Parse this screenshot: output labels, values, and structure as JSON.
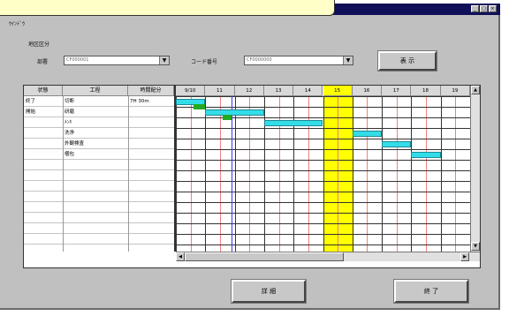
{
  "window": {
    "title_controls": [
      "_",
      "□",
      "×"
    ],
    "top_label": "ｳｲﾝﾄﾞｳ",
    "sub_label": "地区区分"
  },
  "filters": {
    "field1_label": "部署",
    "field1_value": "CF000001",
    "field2_label": "コード番号",
    "field2_value": "CF0000000",
    "show_button": "表 示"
  },
  "left_table": {
    "headers": [
      "状態",
      "工程",
      "時間配分"
    ],
    "rows": [
      {
        "status": "終了",
        "process": "切断",
        "time": "7H 30m"
      },
      {
        "status": "開始",
        "process": "研磨",
        "time": ""
      },
      {
        "status": "",
        "process": "ﾒﾝｷ",
        "time": ""
      },
      {
        "status": "",
        "process": "洗浄",
        "time": ""
      },
      {
        "status": "",
        "process": "外観検査",
        "time": ""
      },
      {
        "status": "",
        "process": "梱包",
        "time": ""
      },
      {
        "status": "",
        "process": "",
        "time": ""
      },
      {
        "status": "",
        "process": "",
        "time": ""
      },
      {
        "status": "",
        "process": "",
        "time": ""
      },
      {
        "status": "",
        "process": "",
        "time": ""
      },
      {
        "status": "",
        "process": "",
        "time": ""
      },
      {
        "status": "",
        "process": "",
        "time": ""
      },
      {
        "status": "",
        "process": "",
        "time": ""
      },
      {
        "status": "",
        "process": "",
        "time": ""
      }
    ]
  },
  "gantt": {
    "columns": [
      "9/10",
      "11",
      "12",
      "13",
      "14",
      "15",
      "16",
      "17",
      "18",
      "19"
    ],
    "highlight_column": 5,
    "bars": [
      {
        "row": 0,
        "start": 0.0,
        "end": 1.0
      },
      {
        "row": 1,
        "start": 1.0,
        "end": 3.0
      },
      {
        "row": 2,
        "start": 3.0,
        "end": 5.0
      },
      {
        "row": 3,
        "start": 6.0,
        "end": 7.0
      },
      {
        "row": 4,
        "start": 7.0,
        "end": 8.0
      },
      {
        "row": 5,
        "start": 8.0,
        "end": 9.0
      }
    ],
    "marks": [
      {
        "row": 0,
        "start": 0.6,
        "end": 1.0
      },
      {
        "row": 1,
        "start": 1.6,
        "end": 1.9
      }
    ],
    "progress_line": 1.9
  },
  "footer": {
    "detail_button": "詳 細",
    "close_button": "終 了"
  },
  "colors": {
    "callout": "#ffffc8",
    "titlebar": "#101058",
    "highlight": "#ffff00",
    "bar": "#33dde8",
    "mark": "#22aa22",
    "gridline_red": "#f08080",
    "progress_line": "#3a3aff"
  }
}
